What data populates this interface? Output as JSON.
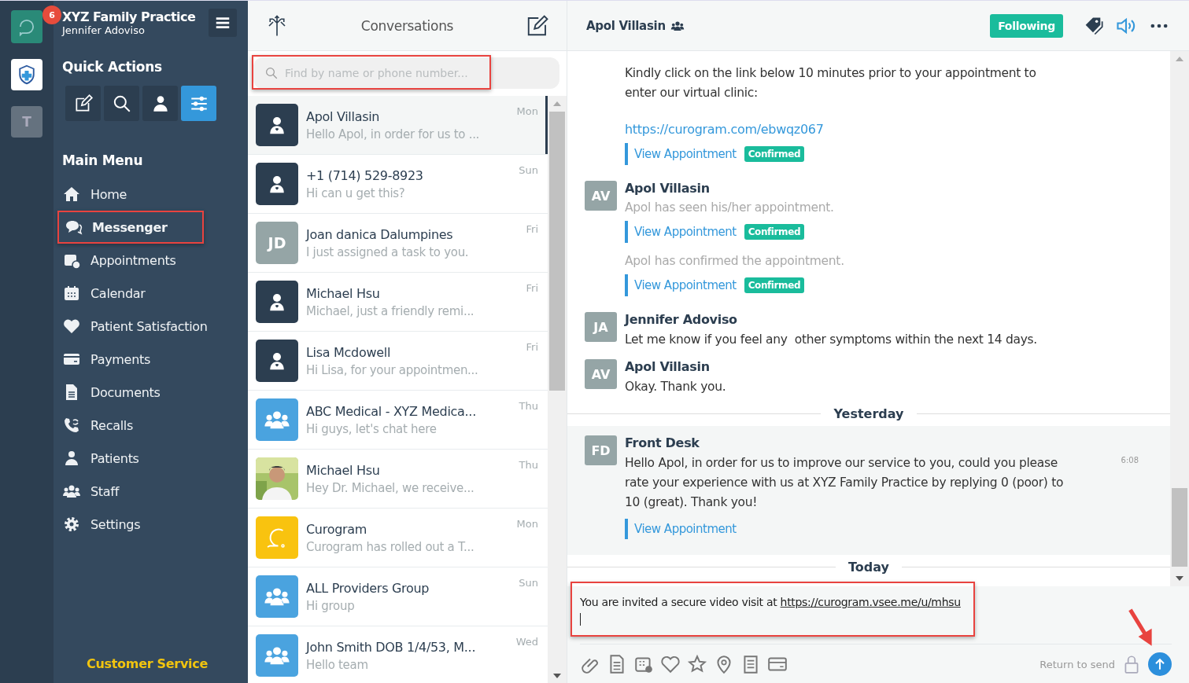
{
  "rail": {
    "badge": "6",
    "workspace_letter": "T"
  },
  "sidebar": {
    "practice": "XYZ Family Practice",
    "user": "Jennifer Adoviso",
    "quick_actions_title": "Quick Actions",
    "quick_actions": [
      {
        "selected": false
      },
      {
        "selected": false
      },
      {
        "selected": false
      },
      {
        "selected": true
      }
    ],
    "main_menu_title": "Main Menu",
    "items": [
      {
        "label": "Home",
        "selected": false
      },
      {
        "label": "Messenger",
        "selected": true
      },
      {
        "label": "Appointments",
        "selected": false
      },
      {
        "label": "Calendar",
        "selected": false
      },
      {
        "label": "Patient Satisfaction",
        "selected": false
      },
      {
        "label": "Payments",
        "selected": false
      },
      {
        "label": "Documents",
        "selected": false
      },
      {
        "label": "Recalls",
        "selected": false
      },
      {
        "label": "Patients",
        "selected": false
      },
      {
        "label": "Staff",
        "selected": false
      },
      {
        "label": "Settings",
        "selected": false
      }
    ],
    "footer": "Customer Service"
  },
  "conversations": {
    "title": "Conversations",
    "search": {
      "placeholder": "Find by name or phone number..."
    },
    "items": [
      {
        "kind": "person",
        "name": "Apol Villasin",
        "preview": "Hello Apol, in order for us to ...",
        "day": "Mon",
        "selected": true
      },
      {
        "kind": "person",
        "name": "+1 (714) 529-8923",
        "preview": "Hi can u get this?",
        "day": "Sun",
        "selected": false
      },
      {
        "kind": "initials",
        "initials": "JD",
        "name": "Joan danica Dalumpines",
        "preview": "I just assigned a task to you.",
        "day": "Fri",
        "selected": false
      },
      {
        "kind": "person",
        "name": "Michael Hsu",
        "preview": "Michael, just a friendly remi...",
        "day": "Fri",
        "selected": false
      },
      {
        "kind": "person",
        "name": "Lisa Mcdowell",
        "preview": "Hi Lisa, for your appointmen...",
        "day": "Fri",
        "selected": false
      },
      {
        "kind": "group",
        "name": "ABC Medical - XYZ Medica...",
        "preview": "Hi guys, let's chat here",
        "day": "Thu",
        "selected": false
      },
      {
        "kind": "picture",
        "name": "Michael Hsu",
        "preview": "Hey Dr. Michael, we receive...",
        "day": "Thu",
        "selected": false
      },
      {
        "kind": "logo",
        "name": "Curogram",
        "preview": "Curogram has rolled out a T...",
        "day": "Mon",
        "selected": false
      },
      {
        "kind": "group",
        "name": "ALL Providers Group",
        "preview": "Hi group",
        "day": "Sun",
        "selected": false
      },
      {
        "kind": "group",
        "name": "John Smith DOB 1/4/53, M...",
        "preview": "Hello team",
        "day": "Wed",
        "selected": false
      }
    ]
  },
  "chat": {
    "contact": "Apol Villasin",
    "follow_button": "Following",
    "messages": [
      {
        "kind": "continuation",
        "lines": [
          "Kindly click on the link below 10 minutes prior to your appointment to enter our virtual clinic:"
        ],
        "link": "https://curogram.com/ebwqz067",
        "appointments": [
          {
            "link": "View Appointment",
            "status": "Confirmed"
          }
        ]
      },
      {
        "kind": "message",
        "initials": "AV",
        "sender": "Apol Villasin",
        "parts": [
          {
            "system": "Apol has seen his/her appointment.",
            "link": "View Appointment",
            "status": "Confirmed"
          },
          {
            "system": "Apol has confirmed the appointment.",
            "link": "View Appointment",
            "status": "Confirmed"
          }
        ]
      },
      {
        "kind": "message",
        "initials": "JA",
        "sender": "Jennifer Adoviso",
        "text": "Let me know if you feel any  other symptoms within the next 14 days."
      },
      {
        "kind": "message",
        "initials": "AV",
        "sender": "Apol Villasin",
        "text": "Okay. Thank you."
      },
      {
        "kind": "divider",
        "label": "Yesterday"
      },
      {
        "kind": "message",
        "highlighted": true,
        "initials": "FD",
        "sender": "Front Desk",
        "text": "Hello Apol, in order for us to improve our service to you, could you please rate your experience with us at XYZ Family Practice by replying 0 (poor) to 10 (great). Thank you!",
        "time": "6:08",
        "parts": [
          {
            "link": "View Appointment"
          }
        ]
      },
      {
        "kind": "divider",
        "label": "Today"
      }
    ],
    "composer": {
      "text": "You are invited a secure video visit at ",
      "link": "https://curogram.vsee.me/u/mhsu",
      "send_hint": "Return to send"
    }
  }
}
